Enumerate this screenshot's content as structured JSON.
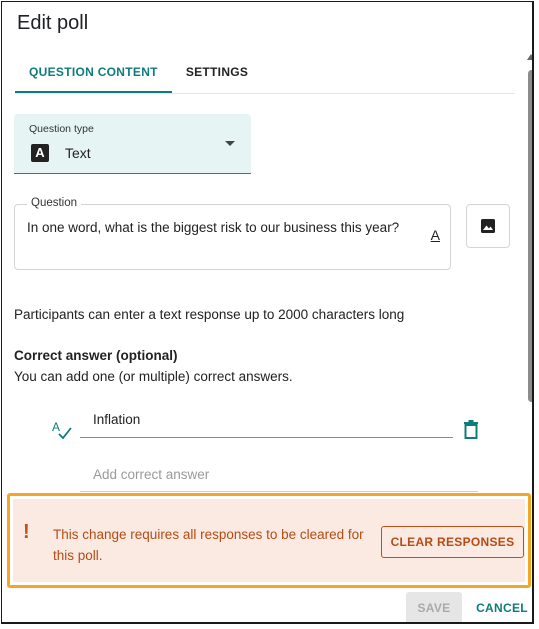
{
  "dialog": {
    "title": "Edit poll"
  },
  "tabs": [
    {
      "label": "QUESTION CONTENT",
      "active": true
    },
    {
      "label": "SETTINGS",
      "active": false
    }
  ],
  "question_type": {
    "label": "Question type",
    "icon_letter": "A",
    "value": "Text"
  },
  "question": {
    "label": "Question",
    "text": "In one word, what is the biggest risk to our business this year?",
    "format_icon": "A"
  },
  "help_text": "Participants can enter a text response up to 2000 characters long",
  "correct_answer": {
    "title": "Correct answer (optional)",
    "subtitle": "You can add one (or multiple) correct answers.",
    "answers": [
      "Inflation"
    ],
    "add_placeholder": "Add correct answer"
  },
  "warning": {
    "icon": "!",
    "text": "This change requires all responses to be cleared for this poll.",
    "button_label": "CLEAR RESPONSES"
  },
  "footer": {
    "save_label": "SAVE",
    "cancel_label": "CANCEL"
  },
  "colors": {
    "accent": "#0e7c7b",
    "warning_text": "#b84a14",
    "warning_bg": "#fbeae2",
    "highlight_border": "#f5a623"
  }
}
